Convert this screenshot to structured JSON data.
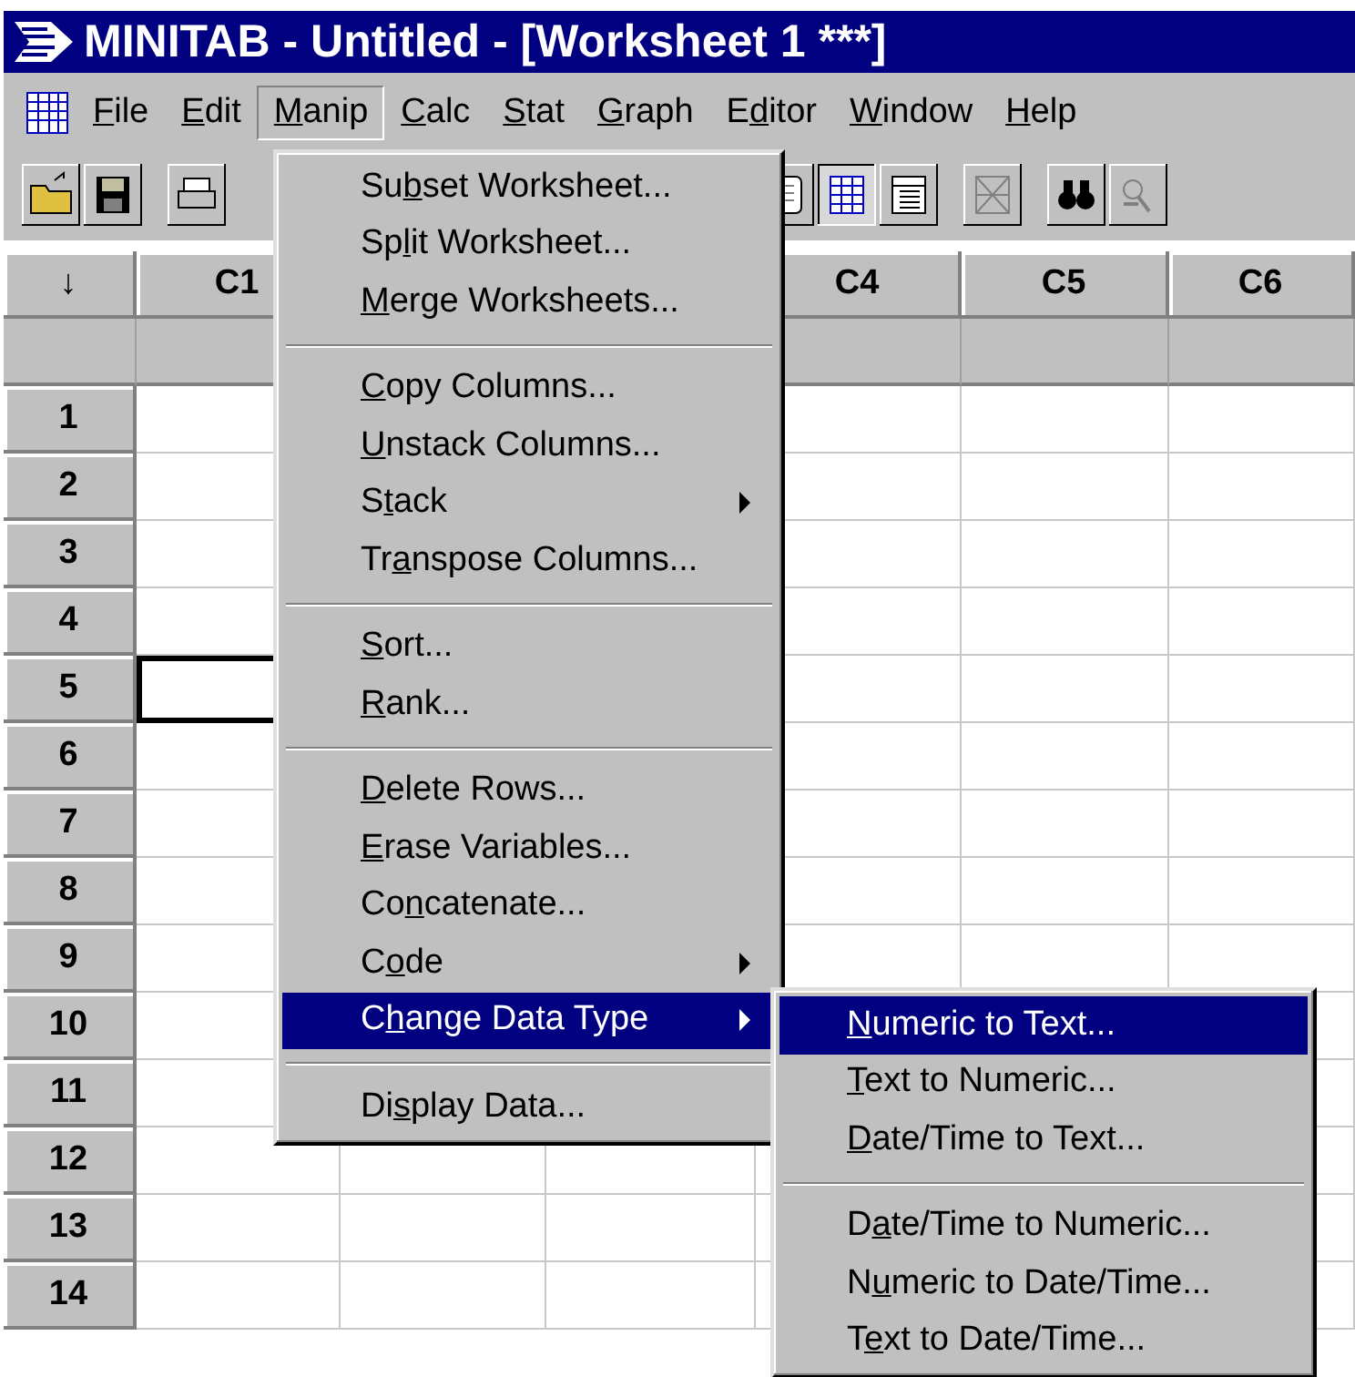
{
  "window": {
    "title": "MINITAB - Untitled - [Worksheet 1 ***]"
  },
  "menubar": [
    {
      "key": "F",
      "post": "ile",
      "selected": false
    },
    {
      "key": "E",
      "post": "dit",
      "selected": false
    },
    {
      "key": "M",
      "post": "anip",
      "selected": true
    },
    {
      "key": "C",
      "post": "alc",
      "selected": false
    },
    {
      "key": "S",
      "post": "tat",
      "selected": false
    },
    {
      "key": "G",
      "post": "raph",
      "selected": false
    },
    {
      "pre": "E",
      "key": "d",
      "post": "itor",
      "selected": false
    },
    {
      "key": "W",
      "post": "indow",
      "selected": false
    },
    {
      "key": "H",
      "post": "elp",
      "selected": false
    }
  ],
  "worksheet": {
    "columns": [
      {
        "label": "C1"
      },
      {},
      {},
      {
        "label": "C4"
      },
      {
        "label": "C5"
      },
      {
        "label": "C6"
      }
    ],
    "corner": "↓",
    "rows": [
      {
        "label": "1",
        "selected": false
      },
      {
        "label": "2",
        "selected": false
      },
      {
        "label": "3",
        "selected": false
      },
      {
        "label": "4",
        "selected": false
      },
      {
        "label": "5",
        "selected": true
      },
      {
        "label": "6",
        "selected": false
      },
      {
        "label": "7",
        "selected": false
      },
      {
        "label": "8",
        "selected": false
      },
      {
        "label": "9",
        "selected": false
      },
      {
        "label": "10",
        "selected": false
      },
      {
        "label": "11",
        "selected": false
      },
      {
        "label": "12",
        "selected": false
      },
      {
        "label": "13",
        "selected": false
      },
      {
        "label": "14",
        "selected": false
      }
    ]
  },
  "manip_menu": {
    "groups": [
      [
        {
          "pre": "Su",
          "key": "b",
          "post": "set Worksheet...",
          "submenu": false,
          "selected": false
        },
        {
          "pre": "Sp",
          "key": "l",
          "post": "it Worksheet...",
          "submenu": false,
          "selected": false
        },
        {
          "key": "M",
          "post": "erge Worksheets...",
          "submenu": false,
          "selected": false
        }
      ],
      [
        {
          "key": "C",
          "post": "opy Columns...",
          "submenu": false,
          "selected": false
        },
        {
          "key": "U",
          "post": "nstack Columns...",
          "submenu": false,
          "selected": false
        },
        {
          "pre": "S",
          "key": "t",
          "post": "ack",
          "submenu": true,
          "selected": false
        },
        {
          "pre": "Tr",
          "key": "a",
          "post": "nspose Columns...",
          "submenu": false,
          "selected": false
        }
      ],
      [
        {
          "key": "S",
          "post": "ort...",
          "submenu": false,
          "selected": false
        },
        {
          "key": "R",
          "post": "ank...",
          "submenu": false,
          "selected": false
        }
      ],
      [
        {
          "key": "D",
          "post": "elete Rows...",
          "submenu": false,
          "selected": false
        },
        {
          "key": "E",
          "post": "rase Variables...",
          "submenu": false,
          "selected": false
        },
        {
          "pre": "Co",
          "key": "n",
          "post": "catenate...",
          "submenu": false,
          "selected": false
        },
        {
          "pre": "C",
          "key": "o",
          "post": "de",
          "submenu": true,
          "selected": false
        },
        {
          "pre": "C",
          "key": "h",
          "post": "ange Data Type",
          "submenu": true,
          "selected": true
        }
      ],
      [
        {
          "pre": "Di",
          "key": "s",
          "post": "play Data...",
          "submenu": false,
          "selected": false
        }
      ]
    ]
  },
  "change_data_type_menu": {
    "groups": [
      [
        {
          "key": "N",
          "post": "umeric to Text...",
          "submenu": false,
          "selected": true
        },
        {
          "key": "T",
          "post": "ext to Numeric...",
          "submenu": false,
          "selected": false
        },
        {
          "key": "D",
          "post": "ate/Time to Text...",
          "submenu": false,
          "selected": false
        }
      ],
      [
        {
          "pre": "D",
          "key": "a",
          "post": "te/Time to Numeric...",
          "submenu": false,
          "selected": false
        },
        {
          "pre": "N",
          "key": "u",
          "post": "meric to Date/Time...",
          "submenu": false,
          "selected": false
        },
        {
          "pre": "T",
          "key": "e",
          "post": "xt to Date/Time...",
          "submenu": false,
          "selected": false
        }
      ]
    ]
  }
}
